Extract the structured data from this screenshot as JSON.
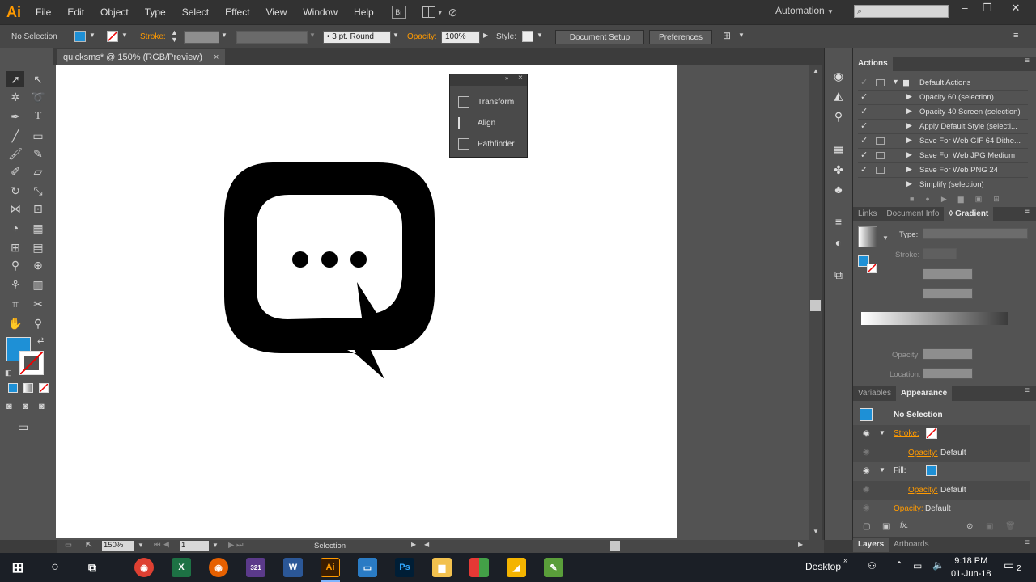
{
  "app": {
    "logo": "Ai",
    "accent": "#ff9a00"
  },
  "menu": [
    "File",
    "Edit",
    "Object",
    "Type",
    "Select",
    "Effect",
    "View",
    "Window",
    "Help"
  ],
  "menubar_extras": {
    "bridge": "Br",
    "workspace": "Automation"
  },
  "controlbar": {
    "selection": "No Selection",
    "fill_color": "#1e90d6",
    "stroke_label": "Stroke:",
    "brush": "3 pt. Round",
    "opacity_label": "Opacity:",
    "opacity_value": "100%",
    "style_label": "Style:",
    "document_setup": "Document Setup",
    "preferences": "Preferences"
  },
  "document_tab": {
    "title": "quicksms* @ 150% (RGB/Preview)",
    "close": "×"
  },
  "float_panel": {
    "items": [
      "Transform",
      "Align",
      "Pathfinder"
    ]
  },
  "actions_panel": {
    "title": "Actions",
    "set": "Default Actions",
    "items": [
      "Opacity 60 (selection)",
      "Opacity 40 Screen (selection)",
      "Apply Default Style (selecti...",
      "Save For Web GIF 64 Dithe...",
      "Save For Web JPG Medium",
      "Save For Web PNG 24",
      "Simplify (selection)"
    ]
  },
  "gradient_panel": {
    "tabs": [
      "Links",
      "Document Info",
      "Gradient"
    ],
    "type_label": "Type:",
    "stroke_label": "Stroke:",
    "opacity_label": "Opacity:",
    "location_label": "Location:"
  },
  "appearance_panel": {
    "tabs": [
      "Variables",
      "Appearance"
    ],
    "header": "No Selection",
    "stroke_label": "Stroke:",
    "opacity_label": "Opacity:",
    "opacity_value": "Default",
    "fill_label": "Fill:",
    "fx": "fx."
  },
  "layers_tabs": [
    "Layers",
    "Artboards"
  ],
  "statusbar": {
    "zoom": "150%",
    "artboard": "1",
    "tool": "Selection"
  },
  "taskbar": {
    "desktop": "Desktop",
    "time": "9:18 PM",
    "date": "01-Jun-18",
    "notifications": "2"
  }
}
